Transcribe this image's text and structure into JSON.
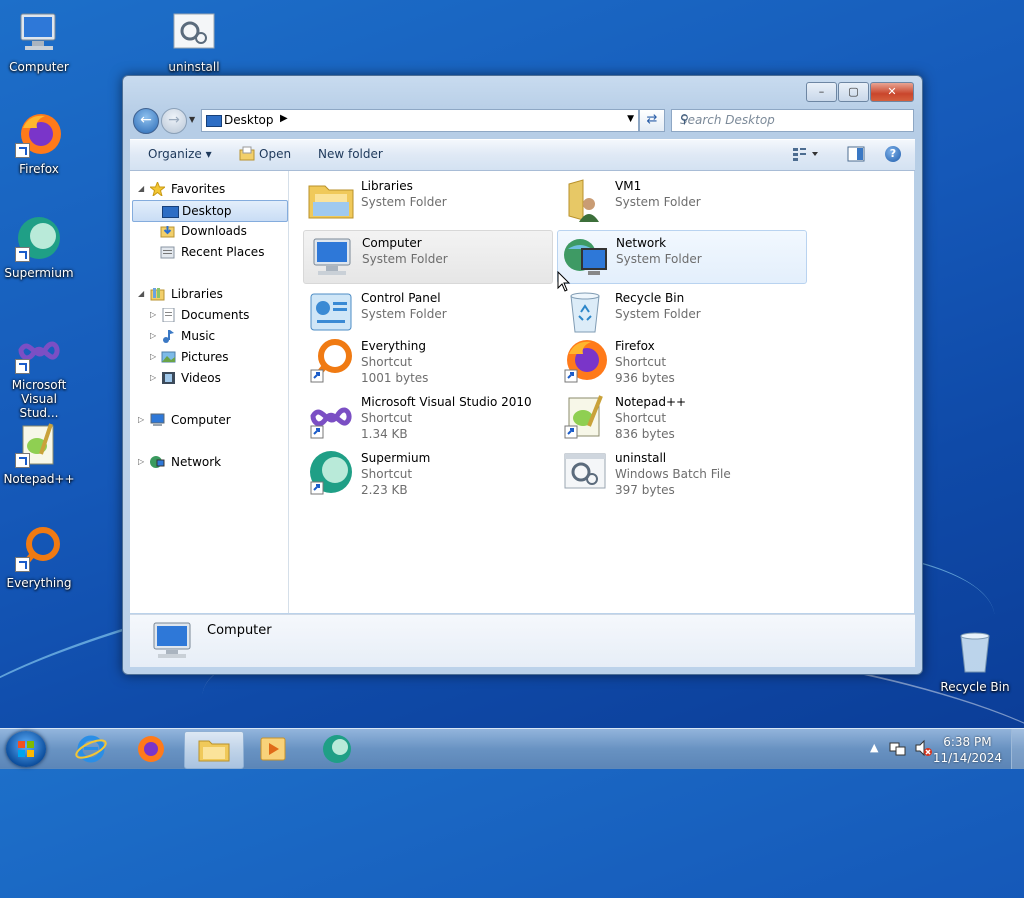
{
  "desktop": {
    "icons": [
      {
        "label": "Computer",
        "icon": "computer-icon"
      },
      {
        "label": "uninstall",
        "icon": "batch-file-icon"
      },
      {
        "label": "Firefox",
        "icon": "firefox-icon"
      },
      {
        "label": "Supermium",
        "icon": "supermium-icon"
      },
      {
        "label": "Microsoft Visual Stud...",
        "icon": "visual-studio-icon"
      },
      {
        "label": "Notepad++",
        "icon": "notepad-plus-plus-icon"
      },
      {
        "label": "Everything",
        "icon": "everything-icon"
      },
      {
        "label": "Recycle Bin",
        "icon": "recycle-bin-icon"
      }
    ]
  },
  "window": {
    "address": {
      "location": "Desktop",
      "search_placeholder": "Search Desktop"
    },
    "caption_buttons": {
      "minimize": "–",
      "maximize": "▢",
      "close": "✕"
    },
    "toolbar": {
      "organize": "Organize",
      "open": "Open",
      "new_folder": "New folder"
    },
    "nav": {
      "favorites": "Favorites",
      "favorites_items": [
        "Desktop",
        "Downloads",
        "Recent Places"
      ],
      "libraries": "Libraries",
      "libraries_items": [
        "Documents",
        "Music",
        "Pictures",
        "Videos"
      ],
      "computer": "Computer",
      "network": "Network"
    },
    "items": [
      {
        "name": "Libraries",
        "type": "System Folder",
        "size": "",
        "icon": "libraries-folder-icon"
      },
      {
        "name": "VM1",
        "type": "System Folder",
        "size": "",
        "icon": "user-folder-icon"
      },
      {
        "name": "Computer",
        "type": "System Folder",
        "size": "",
        "icon": "computer-icon",
        "selected": true
      },
      {
        "name": "Network",
        "type": "System Folder",
        "size": "",
        "icon": "network-icon",
        "hovered": true
      },
      {
        "name": "Control Panel",
        "type": "System Folder",
        "size": "",
        "icon": "control-panel-icon"
      },
      {
        "name": "Recycle Bin",
        "type": "System Folder",
        "size": "",
        "icon": "recycle-bin-icon"
      },
      {
        "name": "Everything",
        "type": "Shortcut",
        "size": "1001 bytes",
        "icon": "everything-icon"
      },
      {
        "name": "Firefox",
        "type": "Shortcut",
        "size": "936 bytes",
        "icon": "firefox-icon"
      },
      {
        "name": "Microsoft Visual Studio 2010",
        "type": "Shortcut",
        "size": "1.34 KB",
        "icon": "visual-studio-icon"
      },
      {
        "name": "Notepad++",
        "type": "Shortcut",
        "size": "836 bytes",
        "icon": "notepad-plus-plus-icon"
      },
      {
        "name": "Supermium",
        "type": "Shortcut",
        "size": "2.23 KB",
        "icon": "supermium-icon"
      },
      {
        "name": "uninstall",
        "type": "Windows Batch File",
        "size": "397 bytes",
        "icon": "batch-file-icon"
      }
    ],
    "details": {
      "selected_name": "Computer"
    }
  },
  "taskbar": {
    "clock_time": "6:38 PM",
    "clock_date": "11/14/2024",
    "apps": [
      "internet-explorer-icon",
      "firefox-icon",
      "explorer-icon",
      "media-player-icon",
      "supermium-icon"
    ]
  },
  "colors": {
    "accent": "#1558b8",
    "selection": "#c9ddf5"
  }
}
